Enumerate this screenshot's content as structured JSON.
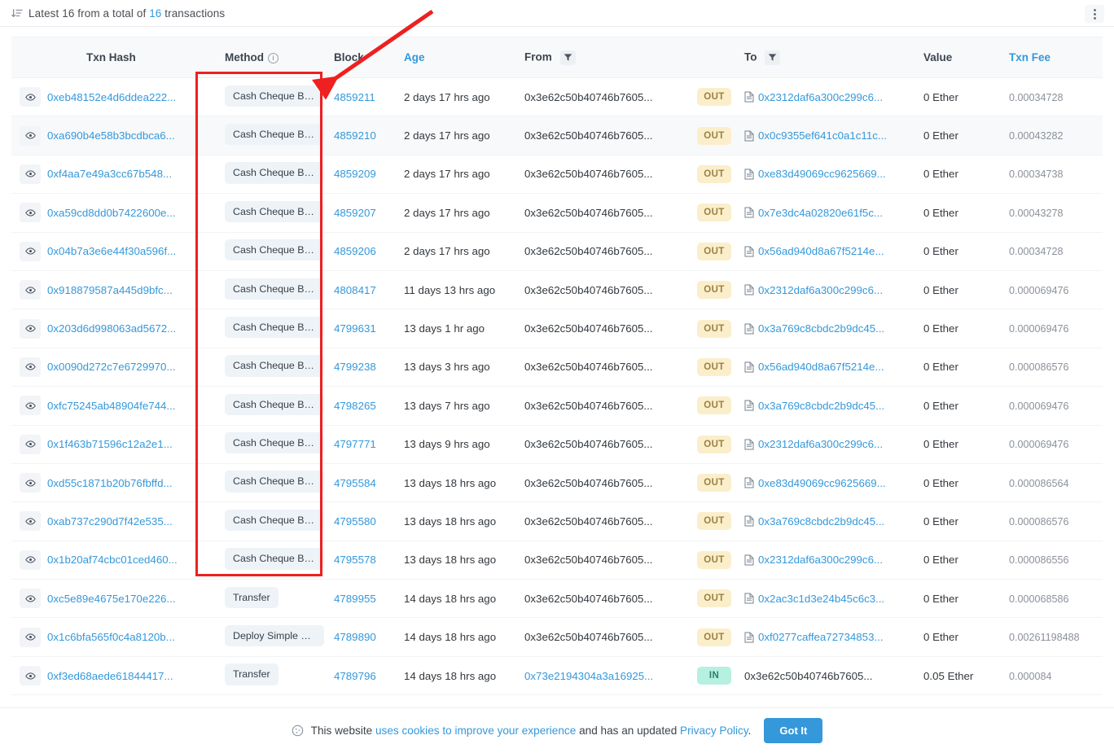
{
  "header": {
    "sort_icon": "sort-icon",
    "summary_prefix": "Latest 16 from a total of ",
    "summary_count": "16",
    "summary_suffix": " transactions",
    "kebab_icon": "more-options-icon"
  },
  "columns": {
    "txn_hash": "Txn Hash",
    "method": "Method",
    "method_info_icon": "info-icon",
    "block": "Block",
    "age": "Age",
    "from": "From",
    "from_filter_icon": "filter-icon",
    "to": "To",
    "to_filter_icon": "filter-icon",
    "value": "Value",
    "txn_fee": "Txn Fee"
  },
  "rows": [
    {
      "eye": "eye-icon",
      "hash": "0xeb48152e4d6ddea222...",
      "method": "Cash Cheque Bene...",
      "block": "4859211",
      "age": "2 days 17 hrs ago",
      "from": "0x3e62c50b40746b7605...",
      "dir": "OUT",
      "to": "0x2312daf6a300c299c6...",
      "to_is_contract": true,
      "value": "0 Ether",
      "fee": "0.00034728"
    },
    {
      "eye": "eye-icon",
      "hash": "0xa690b4e58b3bcdbca6...",
      "method": "Cash Cheque Bene...",
      "block": "4859210",
      "age": "2 days 17 hrs ago",
      "from": "0x3e62c50b40746b7605...",
      "dir": "OUT",
      "to": "0x0c9355ef641c0a1c11c...",
      "to_is_contract": true,
      "value": "0 Ether",
      "fee": "0.00043282"
    },
    {
      "eye": "eye-icon",
      "hash": "0xf4aa7e49a3cc67b548...",
      "method": "Cash Cheque Bene...",
      "block": "4859209",
      "age": "2 days 17 hrs ago",
      "from": "0x3e62c50b40746b7605...",
      "dir": "OUT",
      "to": "0xe83d49069cc9625669...",
      "to_is_contract": true,
      "value": "0 Ether",
      "fee": "0.00034738"
    },
    {
      "eye": "eye-icon",
      "hash": "0xa59cd8dd0b7422600e...",
      "method": "Cash Cheque Bene...",
      "block": "4859207",
      "age": "2 days 17 hrs ago",
      "from": "0x3e62c50b40746b7605...",
      "dir": "OUT",
      "to": "0x7e3dc4a02820e61f5c...",
      "to_is_contract": true,
      "value": "0 Ether",
      "fee": "0.00043278"
    },
    {
      "eye": "eye-icon",
      "hash": "0x04b7a3e6e44f30a596f...",
      "method": "Cash Cheque Bene...",
      "block": "4859206",
      "age": "2 days 17 hrs ago",
      "from": "0x3e62c50b40746b7605...",
      "dir": "OUT",
      "to": "0x56ad940d8a67f5214e...",
      "to_is_contract": true,
      "value": "0 Ether",
      "fee": "0.00034728"
    },
    {
      "eye": "eye-icon",
      "hash": "0x918879587a445d9bfc...",
      "method": "Cash Cheque Bene...",
      "block": "4808417",
      "age": "11 days 13 hrs ago",
      "from": "0x3e62c50b40746b7605...",
      "dir": "OUT",
      "to": "0x2312daf6a300c299c6...",
      "to_is_contract": true,
      "value": "0 Ether",
      "fee": "0.000069476"
    },
    {
      "eye": "eye-icon",
      "hash": "0x203d6d998063ad5672...",
      "method": "Cash Cheque Bene...",
      "block": "4799631",
      "age": "13 days 1 hr ago",
      "from": "0x3e62c50b40746b7605...",
      "dir": "OUT",
      "to": "0x3a769c8cbdc2b9dc45...",
      "to_is_contract": true,
      "value": "0 Ether",
      "fee": "0.000069476"
    },
    {
      "eye": "eye-icon",
      "hash": "0x0090d272c7e6729970...",
      "method": "Cash Cheque Bene...",
      "block": "4799238",
      "age": "13 days 3 hrs ago",
      "from": "0x3e62c50b40746b7605...",
      "dir": "OUT",
      "to": "0x56ad940d8a67f5214e...",
      "to_is_contract": true,
      "value": "0 Ether",
      "fee": "0.000086576"
    },
    {
      "eye": "eye-icon",
      "hash": "0xfc75245ab48904fe744...",
      "method": "Cash Cheque Bene...",
      "block": "4798265",
      "age": "13 days 7 hrs ago",
      "from": "0x3e62c50b40746b7605...",
      "dir": "OUT",
      "to": "0x3a769c8cbdc2b9dc45...",
      "to_is_contract": true,
      "value": "0 Ether",
      "fee": "0.000069476"
    },
    {
      "eye": "eye-icon",
      "hash": "0x1f463b71596c12a2e1...",
      "method": "Cash Cheque Bene...",
      "block": "4797771",
      "age": "13 days 9 hrs ago",
      "from": "0x3e62c50b40746b7605...",
      "dir": "OUT",
      "to": "0x2312daf6a300c299c6...",
      "to_is_contract": true,
      "value": "0 Ether",
      "fee": "0.000069476"
    },
    {
      "eye": "eye-icon",
      "hash": "0xd55c1871b20b76fbffd...",
      "method": "Cash Cheque Bene...",
      "block": "4795584",
      "age": "13 days 18 hrs ago",
      "from": "0x3e62c50b40746b7605...",
      "dir": "OUT",
      "to": "0xe83d49069cc9625669...",
      "to_is_contract": true,
      "value": "0 Ether",
      "fee": "0.000086564"
    },
    {
      "eye": "eye-icon",
      "hash": "0xab737c290d7f42e535...",
      "method": "Cash Cheque Bene...",
      "block": "4795580",
      "age": "13 days 18 hrs ago",
      "from": "0x3e62c50b40746b7605...",
      "dir": "OUT",
      "to": "0x3a769c8cbdc2b9dc45...",
      "to_is_contract": true,
      "value": "0 Ether",
      "fee": "0.000086576"
    },
    {
      "eye": "eye-icon",
      "hash": "0x1b20af74cbc01ced460...",
      "method": "Cash Cheque Bene...",
      "block": "4795578",
      "age": "13 days 18 hrs ago",
      "from": "0x3e62c50b40746b7605...",
      "dir": "OUT",
      "to": "0x2312daf6a300c299c6...",
      "to_is_contract": true,
      "value": "0 Ether",
      "fee": "0.000086556"
    },
    {
      "eye": "eye-icon",
      "hash": "0xc5e89e4675e170e226...",
      "method": "Transfer",
      "block": "4789955",
      "age": "14 days 18 hrs ago",
      "from": "0x3e62c50b40746b7605...",
      "dir": "OUT",
      "to": "0x2ac3c1d3e24b45c6c3...",
      "to_is_contract": true,
      "value": "0 Ether",
      "fee": "0.000068586"
    },
    {
      "eye": "eye-icon",
      "hash": "0x1c6bfa565f0c4a8120b...",
      "method": "Deploy Simple Sw...",
      "block": "4789890",
      "age": "14 days 18 hrs ago",
      "from": "0x3e62c50b40746b7605...",
      "dir": "OUT",
      "to": "0xf0277caffea72734853...",
      "to_is_contract": true,
      "value": "0 Ether",
      "fee": "0.00261198488"
    },
    {
      "eye": "eye-icon",
      "hash": "0xf3ed68aede61844417...",
      "method": "Transfer",
      "block": "4789796",
      "age": "14 days 18 hrs ago",
      "from": "0x73e2194304a3a16925...",
      "from_is_link": true,
      "dir": "IN",
      "to": "0x3e62c50b40746b7605...",
      "to_is_contract": false,
      "value": "0.05 Ether",
      "fee": "0.000084"
    }
  ],
  "cookie_banner": {
    "icon": "cookie-icon",
    "text_before": "This website ",
    "link1": "uses cookies to improve your experience",
    "text_mid": " and has an updated ",
    "link2": "Privacy Policy",
    "text_after": ".",
    "button": "Got It"
  },
  "annotations": {
    "rect_color": "#ee2020",
    "arrow_color": "#ee2020"
  },
  "colors": {
    "link": "#3498db",
    "out_badge_bg": "#fbeeca",
    "in_badge_bg": "#b6f0e0",
    "method_badge_bg": "#eef3f8",
    "header_bg": "#f8f9fa",
    "accent_button": "#3498db"
  }
}
